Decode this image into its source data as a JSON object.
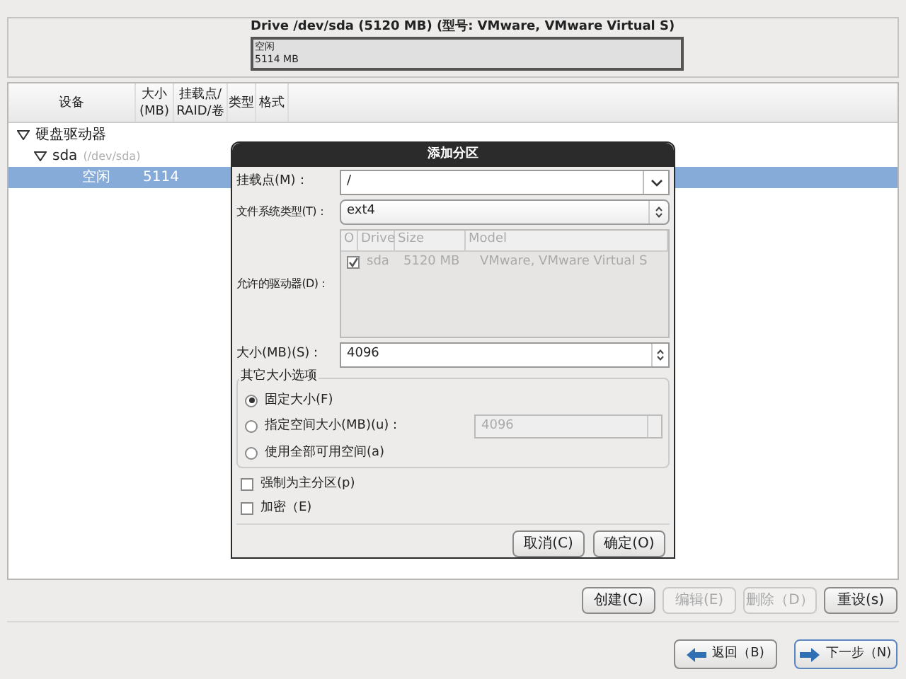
{
  "drive": {
    "title": "Drive /dev/sda (5120 MB) (型号: VMware, VMware Virtual S)",
    "segment_label": "空闲",
    "segment_size": "5114 MB"
  },
  "tree": {
    "columns": [
      "设备",
      "大小\n(MB)",
      "挂载点/\nRAID/卷",
      "类型",
      "格式"
    ],
    "rows": [
      {
        "device": "硬盘驱动器",
        "expanded": true,
        "selected": false,
        "children": [
          {
            "device": "sda",
            "path": "(/dev/sda)",
            "expanded": true,
            "selected": false,
            "children": [
              {
                "device": "空闲",
                "size": "5114",
                "selected": true
              }
            ]
          }
        ]
      }
    ]
  },
  "dialog": {
    "title": "添加分区",
    "mount_label": "挂载点(M)：",
    "mount_value": "/",
    "fs_label": "文件系统类型(T)：",
    "fs_value": "ext4",
    "drives_label": "允许的驱动器(D)：",
    "drives_columns": [
      "O",
      "Drive",
      "Size",
      "Model"
    ],
    "drives": [
      {
        "checked": true,
        "drive": "sda",
        "size": "5120 MB",
        "model": "VMware, VMware Virtual S"
      }
    ],
    "size_label": "大小(MB)(S)：",
    "size_value": "4096",
    "options_title": "其它大小选项",
    "options": [
      {
        "label": "固定大小(F)",
        "selected": true
      },
      {
        "label": "指定空间大小(MB)(u)：",
        "selected": false,
        "value": "4096"
      },
      {
        "label": "使用全部可用空间(a)",
        "selected": false
      }
    ],
    "checks": [
      {
        "label": "强制为主分区(p)",
        "checked": false
      },
      {
        "label": "加密（E)",
        "checked": false
      }
    ],
    "buttons": [
      "取消(C)",
      "确定(O)"
    ]
  },
  "actions": [
    {
      "label": "创建(C)",
      "disabled": false
    },
    {
      "label": "编辑(E)",
      "disabled": true
    },
    {
      "label": "删除（D）",
      "disabled": true
    },
    {
      "label": "重设(s)",
      "disabled": false
    }
  ],
  "nav": [
    {
      "label": "返回（B)",
      "kind": "back"
    },
    {
      "label": "下一步（N)",
      "kind": "next"
    }
  ]
}
